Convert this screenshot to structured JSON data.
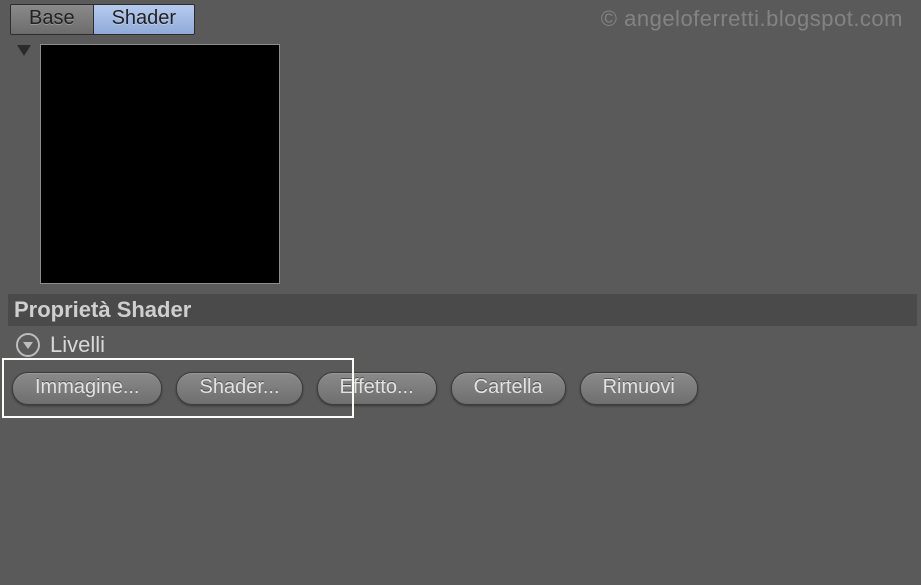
{
  "tabs": {
    "base": "Base",
    "shader": "Shader",
    "active": "shader"
  },
  "watermark": "© angeloferretti.blogspot.com",
  "section": {
    "title": "Proprietà Shader"
  },
  "expand": {
    "label": "Livelli"
  },
  "buttons": {
    "image": "Immagine...",
    "shader": "Shader...",
    "effect": "Effetto...",
    "folder": "Cartella",
    "remove": "Rimuovi"
  }
}
